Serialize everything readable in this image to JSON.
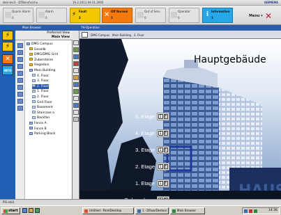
{
  "titlebar": {
    "left": "desi-tec3 - DTBerufsschu",
    "mid": "16.2.2011  04.01.2005",
    "brand": "SIEMENS"
  },
  "statusbar": {
    "buttons": [
      {
        "label": "Quarin Alarm",
        "count": "0"
      },
      {
        "label": "Alarm",
        "count": "0"
      },
      {
        "label": "Fault",
        "count": "2"
      },
      {
        "label": "Off Normal",
        "count": "1"
      },
      {
        "label": "Out of Serv",
        "count": "0"
      },
      {
        "label": "Operator",
        "count": "0"
      },
      {
        "label": "Information",
        "count": "1"
      }
    ],
    "menu_label": "Menu ▾"
  },
  "leftstrip": {
    "info_label": "INFO"
  },
  "tree": {
    "header": "Main Browser",
    "tab_preferred": "Preferred View",
    "tab_main": "Main View",
    "items": [
      {
        "label": "DMG Campus",
        "indent": 0,
        "kind": "bld"
      },
      {
        "label": "Gesellb",
        "indent": 1,
        "kind": "folder"
      },
      {
        "label": "DMG/DMG Grid",
        "indent": 1,
        "kind": "folder"
      },
      {
        "label": "Zubersteine",
        "indent": 1,
        "kind": "folder"
      },
      {
        "label": "Hegedoin",
        "indent": 1,
        "kind": "folder"
      },
      {
        "label": "Main Building",
        "indent": 1,
        "kind": "bld"
      },
      {
        "label": "4. Floor",
        "indent": 2,
        "kind": "floor"
      },
      {
        "label": "3. Floor",
        "indent": 2,
        "kind": "floor"
      },
      {
        "label": "2. Floor",
        "indent": 2,
        "kind": "floor",
        "selected": true
      },
      {
        "label": "1. Floor",
        "indent": 2,
        "kind": "floor"
      },
      {
        "label": "2. Floor",
        "indent": 2,
        "kind": "floor"
      },
      {
        "label": "Gnd Floor",
        "indent": 2,
        "kind": "floor"
      },
      {
        "label": "Basement",
        "indent": 2,
        "kind": "floor"
      },
      {
        "label": "Staircase a",
        "indent": 2,
        "kind": "floor"
      },
      {
        "label": "Backfan",
        "indent": 2,
        "kind": "floor"
      },
      {
        "label": "Fence A",
        "indent": 1,
        "kind": "bld"
      },
      {
        "label": "Fence B",
        "indent": 1,
        "kind": "bld"
      },
      {
        "label": "Parking Block",
        "indent": 1,
        "kind": "bld"
      }
    ]
  },
  "main": {
    "header": "TH-Operation",
    "breadcrumb": "DMG Campus . Main Building . 3. Floor",
    "title": "Hauptgebäude",
    "floors": [
      {
        "label": "5. Etage",
        "b1": "1",
        "b2": "E"
      },
      {
        "label": "4. Etage",
        "b1": "1",
        "b2": "E"
      },
      {
        "label": "3. Etage",
        "b1": "1",
        "b2": "E"
      },
      {
        "label": "2. Etage",
        "b1": "1",
        "b2": "E"
      },
      {
        "label": "1. Etage",
        "b1": "1",
        "b2": "E"
      },
      {
        "label": "Erdgeschoss",
        "b1": "1",
        "b2": "E"
      }
    ]
  },
  "lowerstrip": {
    "text": "PSI  ete2"
  },
  "taskbar": {
    "start": "start",
    "tasks": [
      "Untitled - PaintDesktop",
      "1 · DFase/Destoor",
      "Main Browser"
    ],
    "clock": "14:36"
  },
  "colors": {
    "fault": "#f4c800",
    "offnormal": "#f47a10",
    "info": "#26a8e8",
    "header_blue": "#2a5cac"
  }
}
